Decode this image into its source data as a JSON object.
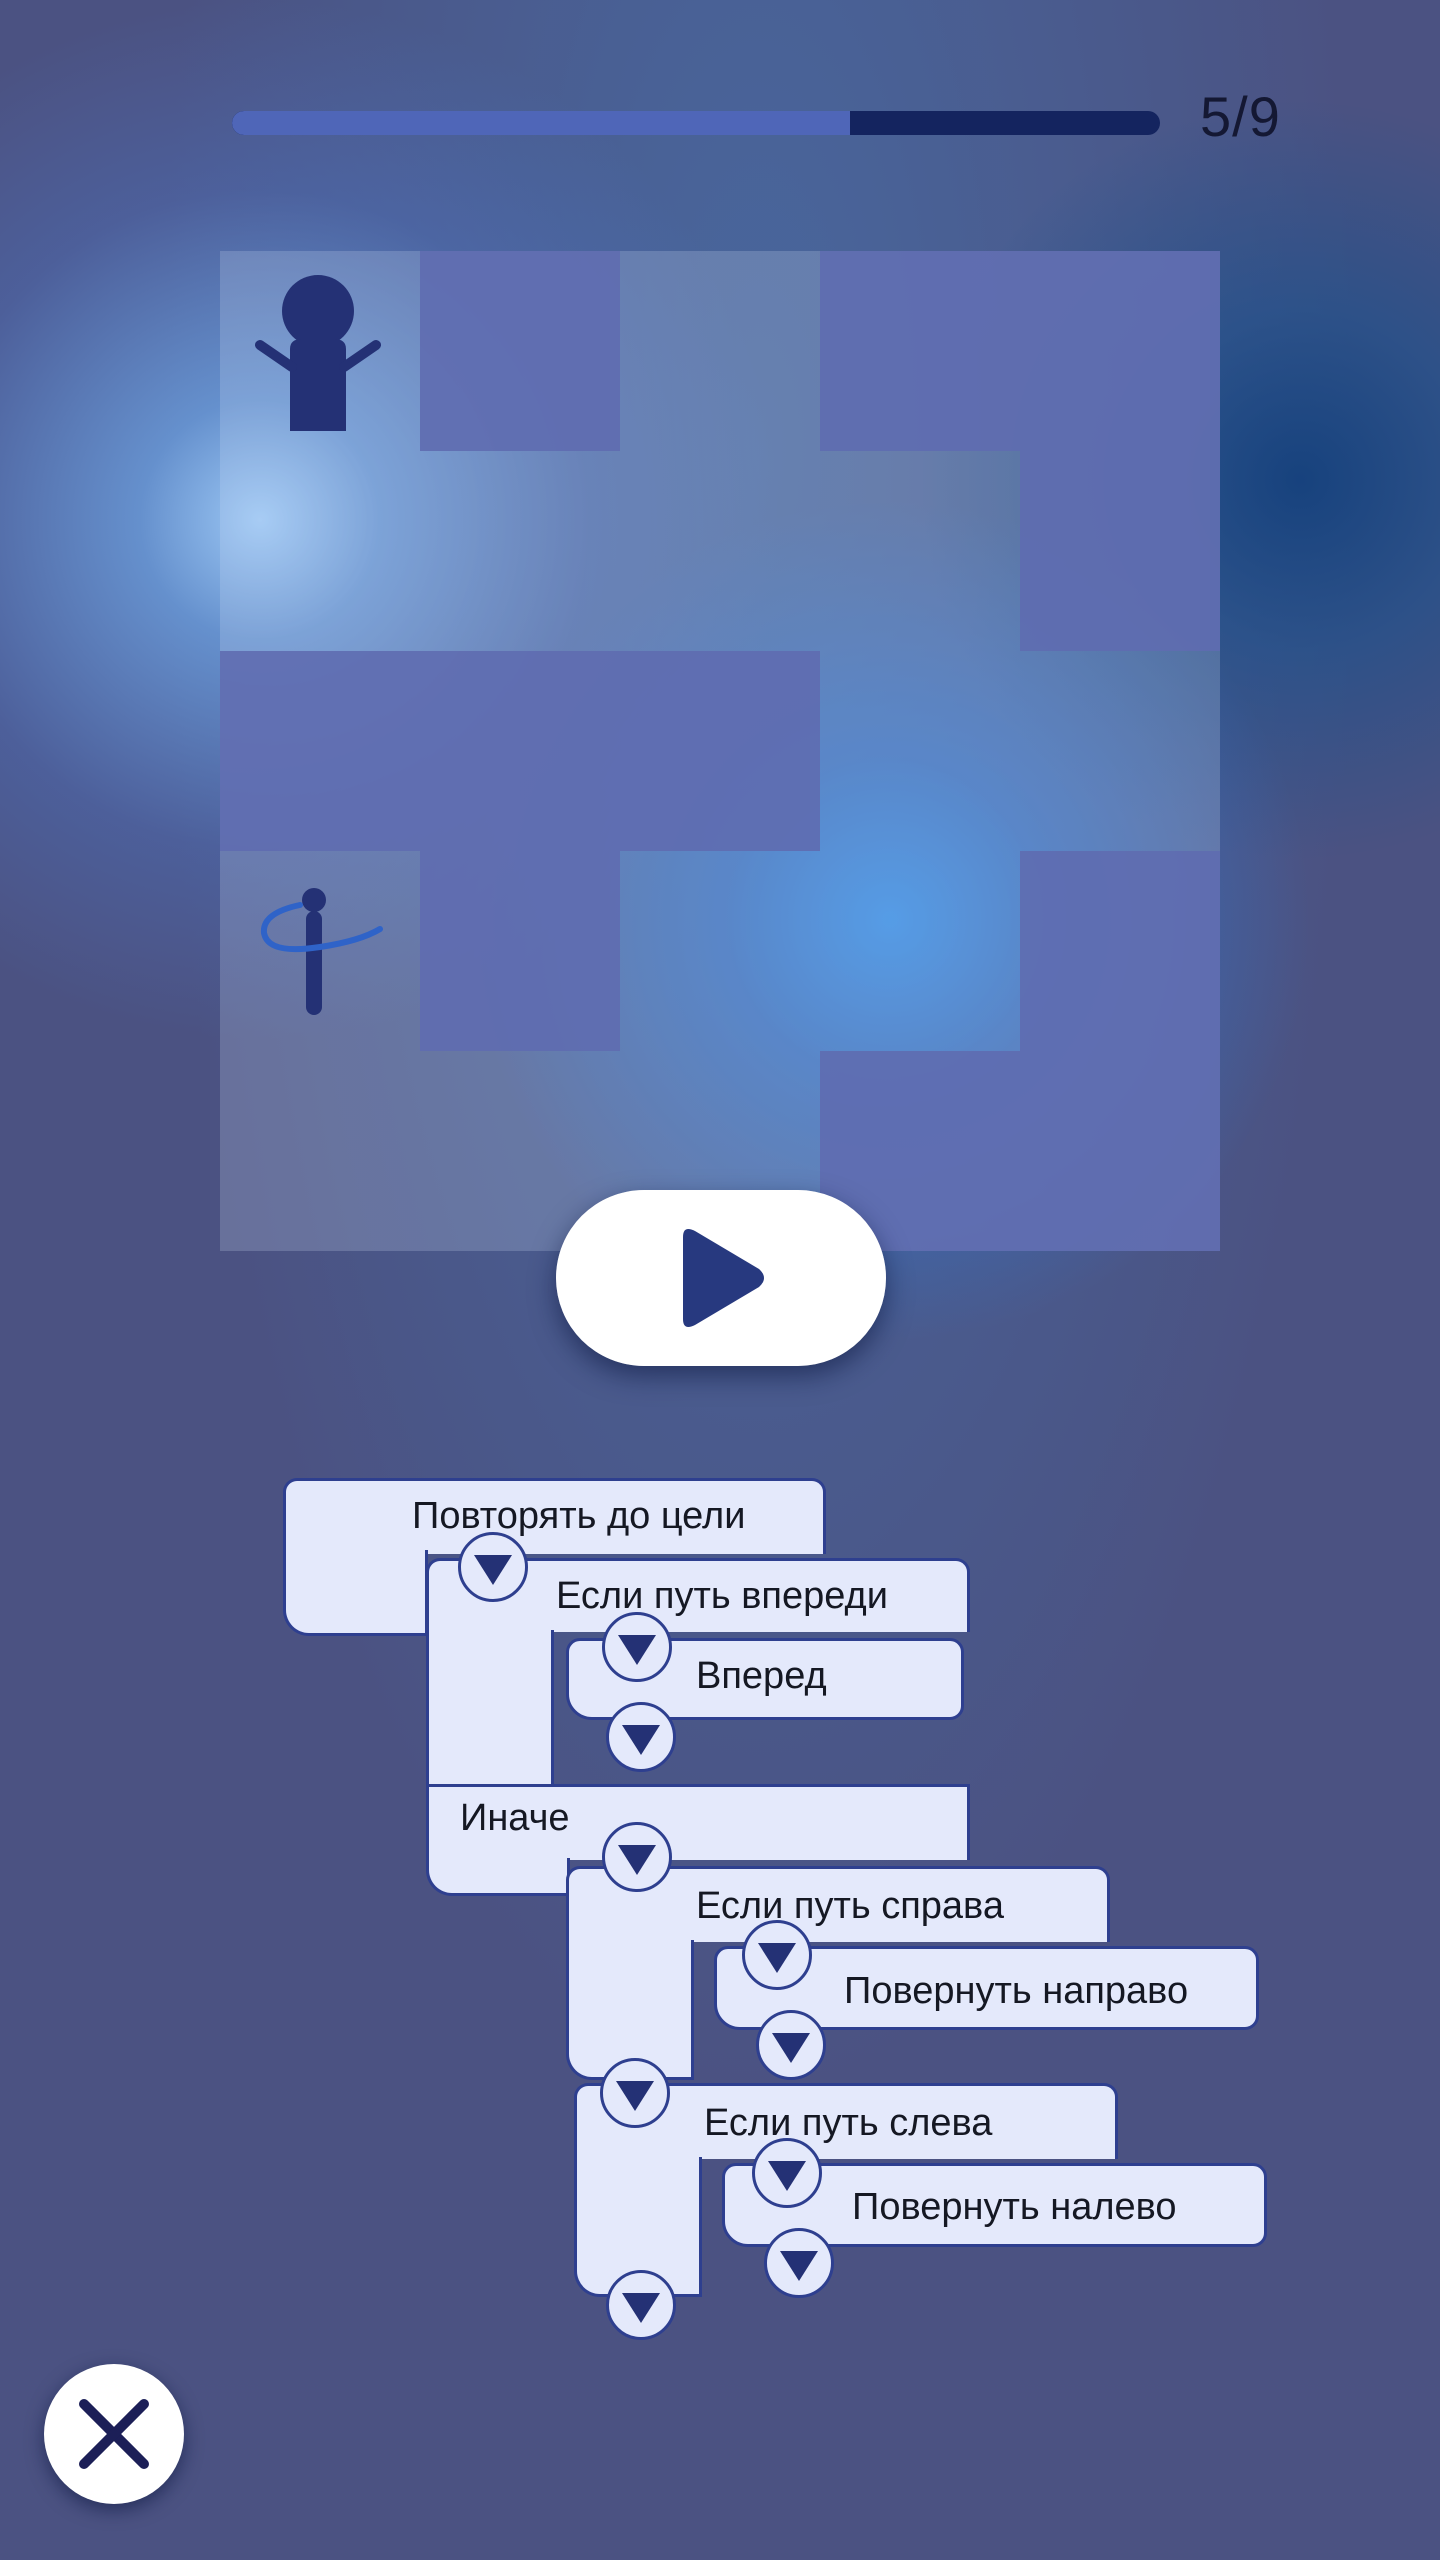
{
  "progress": {
    "label": "5/9",
    "fraction": 0.666
  },
  "maze": {
    "rows": 5,
    "cols": 5,
    "layout": [
      [
        "path",
        "wall",
        "path",
        "wall",
        "wall"
      ],
      [
        "path",
        "path",
        "path",
        "path",
        "wall"
      ],
      [
        "wall",
        "wall",
        "wall",
        "path",
        "path"
      ],
      [
        "path",
        "wall",
        "path",
        "path",
        "wall"
      ],
      [
        "path",
        "path",
        "path",
        "wall",
        "wall"
      ]
    ],
    "goal": {
      "row": 0,
      "col": 0,
      "icon": "person-goal-icon"
    },
    "player": {
      "row": 3,
      "col": 0,
      "icon": "spinning-figure-icon"
    }
  },
  "play_button": {
    "icon": "play-icon"
  },
  "close_button": {
    "icon": "close-icon"
  },
  "program": {
    "repeat": "Повторять до цели",
    "if_ahead": "Если путь впереди",
    "forward": "Вперед",
    "else": "Иначе",
    "if_right": "Если путь справа",
    "turn_right": "Повернуть направо",
    "if_left": "Если путь слева",
    "turn_left": "Повернуть налево"
  },
  "colors": {
    "background": "#4b5282",
    "wall": "#626fb2",
    "block_fill": "#e4e9fb",
    "block_border": "#2e3f8f",
    "accent": "#243175",
    "progress_track": "#14245f",
    "progress_fill": "#4f66b8"
  }
}
